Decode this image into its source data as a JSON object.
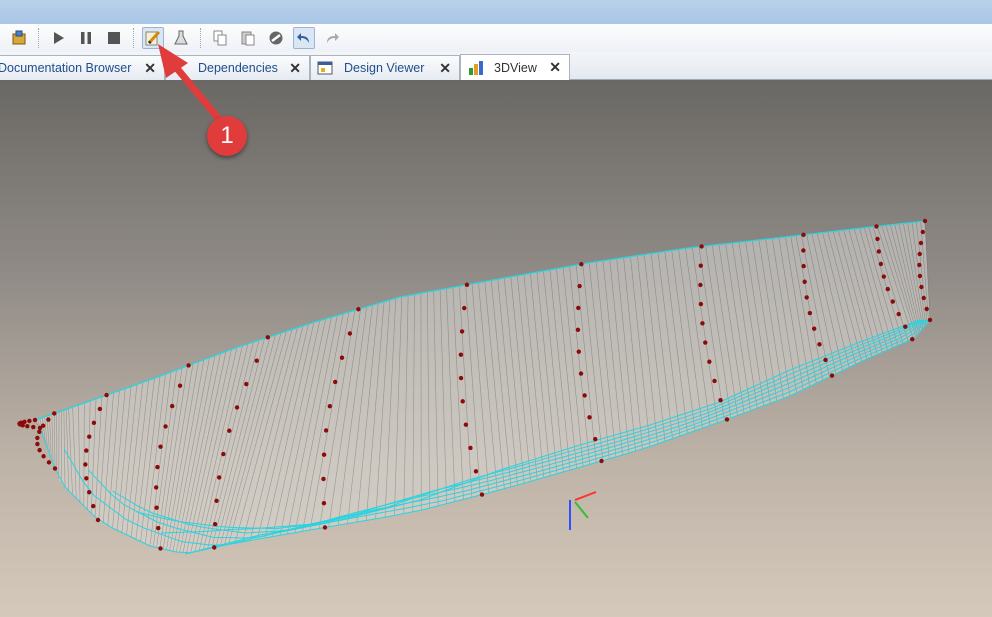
{
  "toolbar": {
    "buttons": [
      {
        "name": "model-icon-button",
        "icon": "model-icon"
      },
      {
        "name": "run-button",
        "icon": "play-icon"
      },
      {
        "name": "pause-button",
        "icon": "pause-icon"
      },
      {
        "name": "stop-button",
        "icon": "stop-icon"
      },
      {
        "name": "edit-button",
        "icon": "pencil-icon",
        "active": true
      },
      {
        "name": "debug-button",
        "icon": "flask-icon"
      },
      {
        "name": "copy-button",
        "icon": "copy-icon"
      },
      {
        "name": "paste-button",
        "icon": "paste-icon"
      },
      {
        "name": "cancel-button",
        "icon": "no-entry-icon"
      },
      {
        "name": "undo-button",
        "icon": "undo-icon",
        "active": true
      },
      {
        "name": "redo-button",
        "icon": "redo-icon"
      }
    ]
  },
  "tabs": [
    {
      "label": "Documentation Browser",
      "icon": "none",
      "selected": false
    },
    {
      "label": "Dependencies",
      "icon": "none",
      "selected": false
    },
    {
      "label": "Design Viewer",
      "icon": "design-viewer-icon",
      "selected": false
    },
    {
      "label": "3DView",
      "icon": "3d-chart-icon",
      "selected": true
    }
  ],
  "tab_close_glyph": "✕",
  "callout": {
    "number": "1",
    "color": "#e03c3c"
  },
  "viewport": {
    "background_top": "#6a6864",
    "background_bottom": "#d5c9bb",
    "mesh_color": "#29d3e0",
    "point_color": "#8b0a0a",
    "object": "boat-hull-wireframe"
  }
}
